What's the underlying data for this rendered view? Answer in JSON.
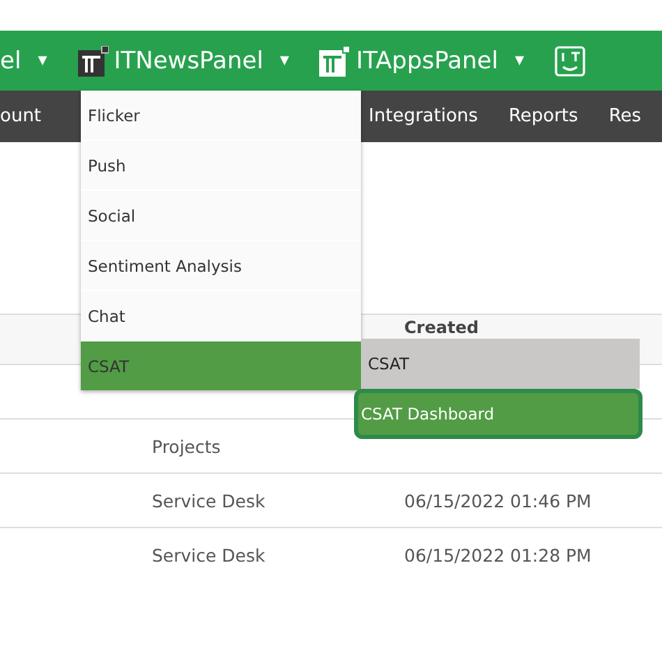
{
  "top_bar": {
    "panels": [
      {
        "label": "el",
        "caret": "▾"
      },
      {
        "label": "ITNewsPanel",
        "caret": "▾"
      },
      {
        "label": "ITAppsPanel",
        "caret": "▾"
      }
    ]
  },
  "nav": {
    "items": [
      {
        "label": "ount"
      },
      {
        "label": "Integrations"
      },
      {
        "label": "Reports"
      },
      {
        "label": "Res"
      }
    ]
  },
  "dropdown": {
    "items": [
      {
        "label": "Flicker",
        "selected": false
      },
      {
        "label": "Push",
        "selected": false
      },
      {
        "label": "Social",
        "selected": false
      },
      {
        "label": "Sentiment Analysis",
        "selected": false
      },
      {
        "label": "Chat",
        "selected": false
      },
      {
        "label": "CSAT",
        "selected": true
      }
    ]
  },
  "submenu": {
    "items": [
      {
        "label": "CSAT",
        "selected": false
      },
      {
        "label": "CSAT Dashboard",
        "selected": true
      }
    ]
  },
  "table": {
    "columns": [
      "Created"
    ],
    "rows": [
      {
        "group": "Projects",
        "created": ""
      },
      {
        "group": "Service Desk",
        "created": "06/15/2022 01:46 PM"
      },
      {
        "group": "Service Desk",
        "created": "06/15/2022 01:28 PM"
      }
    ]
  }
}
